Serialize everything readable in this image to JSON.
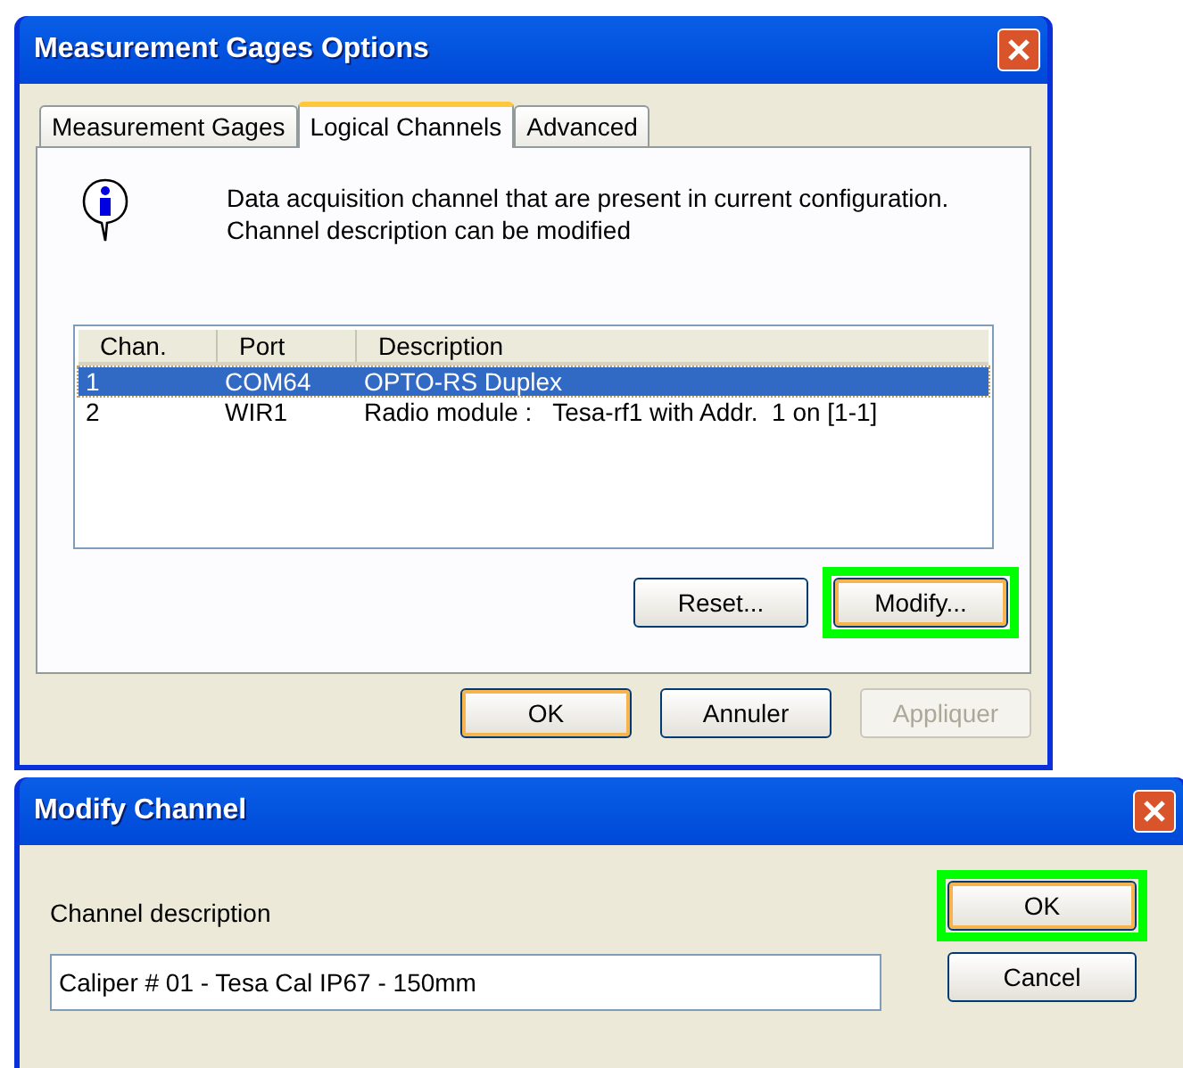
{
  "options_dialog": {
    "title": "Measurement Gages Options",
    "tabs": [
      {
        "label": "Measurement Gages",
        "selected": false
      },
      {
        "label": "Logical Channels",
        "selected": true
      },
      {
        "label": "Advanced",
        "selected": false
      }
    ],
    "info_lines": [
      "Data acquisition channel that are present in current configuration.",
      "Channel description can be modified"
    ],
    "table": {
      "columns": [
        "Chan.",
        "Port",
        "Description"
      ],
      "rows": [
        {
          "cells": [
            "1",
            "COM64",
            "OPTO-RS Duplex"
          ],
          "selected": true
        },
        {
          "cells": [
            "2",
            "WIR1",
            "Radio module :   Tesa-rf1 with Addr.  1 on [1-1]"
          ],
          "selected": false
        }
      ]
    },
    "panel_buttons": [
      {
        "label": "Reset...",
        "default": false,
        "highlighted": false,
        "disabled": false
      },
      {
        "label": "Modify...",
        "default": true,
        "highlighted": true,
        "disabled": false
      }
    ],
    "buttons": [
      {
        "label": "OK",
        "default": true,
        "highlighted": false,
        "disabled": false
      },
      {
        "label": "Annuler",
        "default": false,
        "highlighted": false,
        "disabled": false
      },
      {
        "label": "Appliquer",
        "default": false,
        "highlighted": false,
        "disabled": true
      }
    ]
  },
  "modify_dialog": {
    "title": "Modify Channel",
    "field_label": "Channel description",
    "field_value": "Caliper # 01 - Tesa Cal IP67 - 150mm",
    "buttons": [
      {
        "label": "OK",
        "default": true,
        "highlighted": true,
        "disabled": false
      },
      {
        "label": "Cancel",
        "default": false,
        "highlighted": false,
        "disabled": false
      }
    ]
  }
}
